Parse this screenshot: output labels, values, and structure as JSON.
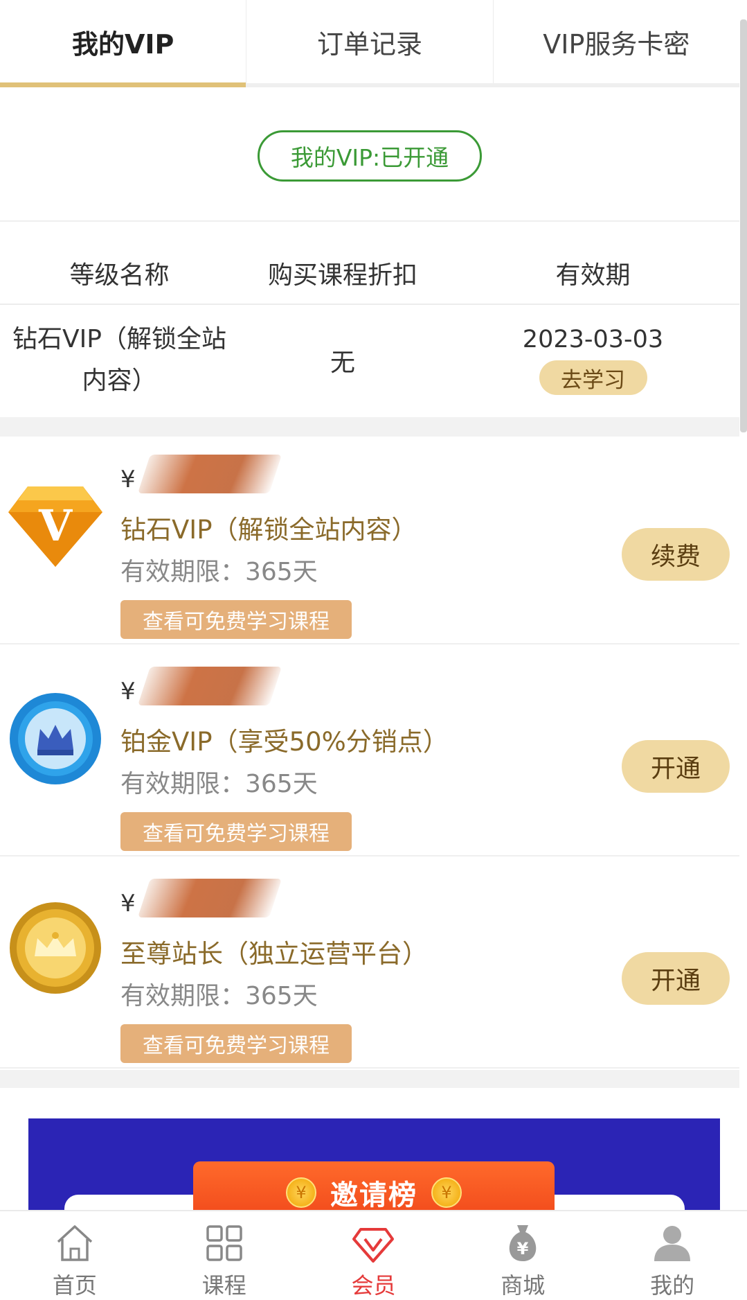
{
  "tabs": [
    {
      "label": "我的VIP",
      "active": true
    },
    {
      "label": "订单记录",
      "active": false
    },
    {
      "label": "VIP服务卡密",
      "active": false
    }
  ],
  "status": {
    "label": "我的VIP:已开通"
  },
  "table": {
    "headers": [
      "等级名称",
      "购买课程折扣",
      "有效期"
    ],
    "rows": [
      {
        "name_line1": "钻石VIP（解锁全站",
        "name_line2": "内容）",
        "discount": "无",
        "valid_until": "2023-03-03",
        "action": "去学习"
      }
    ]
  },
  "cards": [
    {
      "currency": "¥",
      "title": "钻石VIP（解锁全站内容）",
      "validity": "有效期限：365天",
      "free_courses_label": "查看可免费学习课程",
      "action_label": "续费",
      "badge": "diamond-v-icon"
    },
    {
      "currency": "¥",
      "title": "铂金VIP（享受50%分销点）",
      "validity": "有效期限：365天",
      "free_courses_label": "查看可免费学习课程",
      "action_label": "开通",
      "badge": "platinum-crown-medal-icon"
    },
    {
      "currency": "¥",
      "title": "至尊站长（独立运营平台）",
      "validity": "有效期限：365天",
      "free_courses_label": "查看可免费学习课程",
      "action_label": "开通",
      "badge": "gold-crown-medal-icon"
    }
  ],
  "banner": {
    "title": "邀请榜",
    "coin_symbol": "¥"
  },
  "bottom_nav": [
    {
      "label": "首页",
      "icon": "home-icon",
      "active": false
    },
    {
      "label": "课程",
      "icon": "grid-icon",
      "active": false
    },
    {
      "label": "会员",
      "icon": "vip-diamond-icon",
      "active": true
    },
    {
      "label": "商城",
      "icon": "money-bag-icon",
      "active": false
    },
    {
      "label": "我的",
      "icon": "user-icon",
      "active": false
    }
  ],
  "colors": {
    "accent_gold": "#e0c178",
    "green": "#3b9a36",
    "active_red": "#e53a3a",
    "button_gold": "#f0d9a2",
    "free_button": "#e5b07a"
  }
}
